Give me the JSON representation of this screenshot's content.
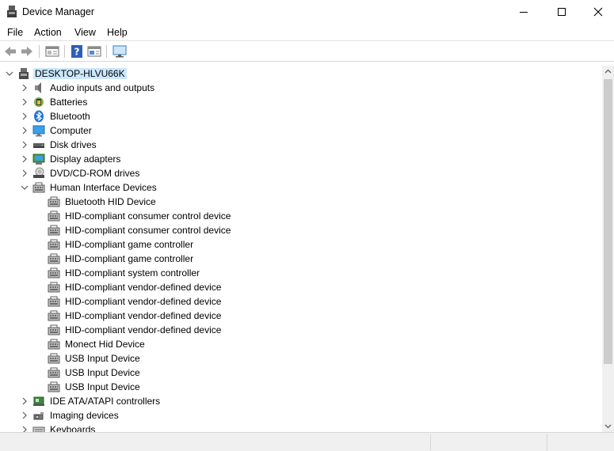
{
  "window": {
    "title": "Device Manager"
  },
  "menu": {
    "items": [
      "File",
      "Action",
      "View",
      "Help"
    ]
  },
  "toolbar": {
    "buttons": [
      "back-icon",
      "forward-icon",
      "properties-pane-icon",
      "help-icon",
      "show-hide-icon",
      "monitor-icon"
    ]
  },
  "tree": {
    "root": "DESKTOP-HLVU66K",
    "categories": [
      {
        "label": "Audio inputs and outputs",
        "icon": "speaker-icon",
        "expanded": false
      },
      {
        "label": "Batteries",
        "icon": "battery-icon",
        "expanded": false
      },
      {
        "label": "Bluetooth",
        "icon": "bluetooth-icon",
        "expanded": false
      },
      {
        "label": "Computer",
        "icon": "computer-icon",
        "expanded": false
      },
      {
        "label": "Disk drives",
        "icon": "disk-drive-icon",
        "expanded": false
      },
      {
        "label": "Display adapters",
        "icon": "display-adapter-icon",
        "expanded": false
      },
      {
        "label": "DVD/CD-ROM drives",
        "icon": "dvd-drive-icon",
        "expanded": false
      },
      {
        "label": "Human Interface Devices",
        "icon": "hid-icon",
        "expanded": true,
        "children": [
          "Bluetooth HID Device",
          "HID-compliant consumer control device",
          "HID-compliant consumer control device",
          "HID-compliant game controller",
          "HID-compliant game controller",
          "HID-compliant system controller",
          "HID-compliant vendor-defined device",
          "HID-compliant vendor-defined device",
          "HID-compliant vendor-defined device",
          "HID-compliant vendor-defined device",
          "Monect Hid Device",
          "USB Input Device",
          "USB Input Device",
          "USB Input Device"
        ]
      },
      {
        "label": "IDE ATA/ATAPI controllers",
        "icon": "ide-controller-icon",
        "expanded": false
      },
      {
        "label": "Imaging devices",
        "icon": "camera-icon",
        "expanded": false
      },
      {
        "label": "Keyboards",
        "icon": "keyboard-icon",
        "expanded": false
      }
    ]
  },
  "colors": {
    "selection": "#cce8ff",
    "accent_blue": "#1e73d8"
  }
}
